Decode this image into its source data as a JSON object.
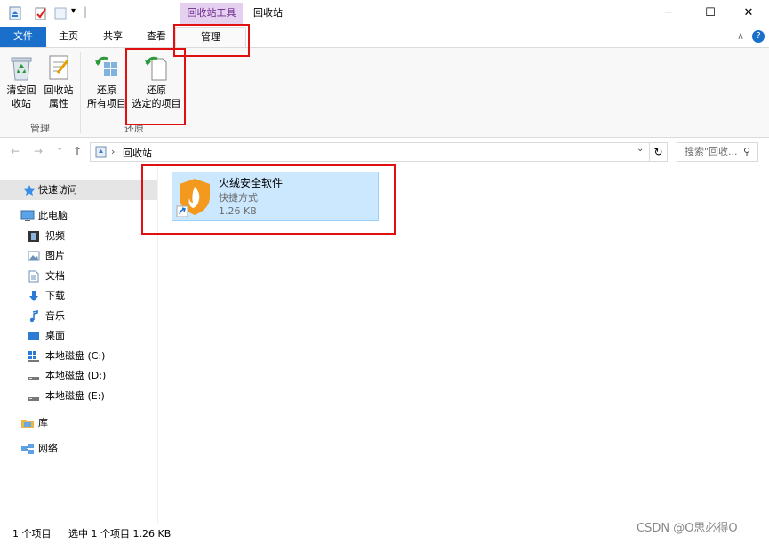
{
  "titlebar": {
    "context_tab": "回收站工具",
    "title": "回收站",
    "quick_access_separator": "|",
    "dropdown": "▾",
    "minimize": "─",
    "maximize": "☐",
    "close": "✕"
  },
  "tabs": {
    "file": "文件",
    "home": "主页",
    "share": "共享",
    "view": "查看",
    "manage": "管理",
    "collapse": "∧",
    "help": "?"
  },
  "ribbon": {
    "empty_bin_line1": "清空回",
    "empty_bin_line2": "收站",
    "bin_props_line1": "回收站",
    "bin_props_line2": "属性",
    "group_manage": "管理",
    "restore_all_line1": "还原",
    "restore_all_line2": "所有项目",
    "restore_sel_line1": "还原",
    "restore_sel_line2": "选定的项目",
    "group_restore": "还原"
  },
  "address": {
    "back": "←",
    "forward": "→",
    "recent": "⌄",
    "up": "↑",
    "separator": "›",
    "location": "回收站",
    "dropdown": "⌄",
    "refresh": "↻",
    "search_placeholder": "搜索\"回收...",
    "search_icon": "⚲"
  },
  "nav": {
    "quick_access": "快速访问",
    "this_pc": "此电脑",
    "videos": "视频",
    "pictures": "图片",
    "documents": "文档",
    "downloads": "下载",
    "music": "音乐",
    "desktop": "桌面",
    "drive_c": "本地磁盘 (C:)",
    "drive_d": "本地磁盘 (D:)",
    "drive_e": "本地磁盘 (E:)",
    "libraries": "库",
    "network": "网络"
  },
  "file": {
    "name": "火绒安全软件",
    "type": "快捷方式",
    "size": "1.26 KB"
  },
  "status": {
    "count": "1 个项目",
    "selected": "选中 1 个项目  1.26 KB",
    "watermark": "CSDN @O思必得O"
  },
  "colors": {
    "file_tab": "#1a6fcb",
    "selection": "#cce8ff",
    "annotation": "#e01010",
    "context_tab": "#e6d0f0"
  }
}
